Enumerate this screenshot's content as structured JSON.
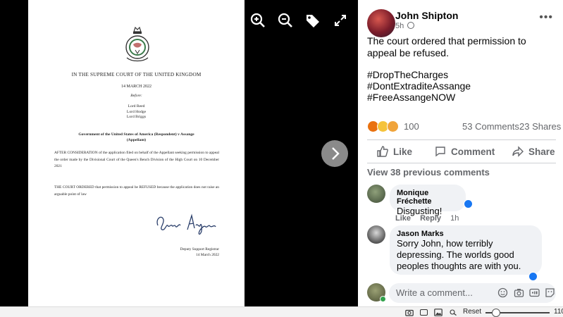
{
  "document": {
    "court": "IN THE SUPREME COURT OF THE UNITED KINGDOM",
    "date": "14 MARCH 2022",
    "before": "Before:",
    "judges": [
      "Lord Reed",
      "Lord Hodge",
      "Lord Briggs"
    ],
    "parties": "Government of the United States of America (Respondent) v Assange (Appellant)",
    "paragraph1": "AFTER CONSIDERATION of the application filed on behalf of the Appellant seeking permission to appeal the order made by the Divisional Court of the Queen's Bench Division of the High Court on 10 December 2021",
    "paragraph2": "THE COURT ORDERED that permission to appeal be REFUSED because the application does not raise an arguable point of law",
    "signature": "Louise Angus",
    "registrar_title": "Deputy Support Registrar",
    "registrar_date": "14 March 2022"
  },
  "viewer": {
    "zoom_in_icon": "zoom-in-icon",
    "zoom_out_icon": "zoom-out-icon",
    "tag_icon": "tag-icon",
    "fullscreen_icon": "fullscreen-icon",
    "next_icon": "chevron-right-icon"
  },
  "post": {
    "author": "John Shipton",
    "time": "5h",
    "text": "The court ordered that permission to appeal be refused.",
    "hashtags": [
      "#DropTheCharges",
      "#DontExtraditeAssange",
      "#FreeAssangeNOW"
    ],
    "reaction_count": "100",
    "comments_count": "53 Comments",
    "shares_count": "23 Shares",
    "actions": {
      "like": "Like",
      "comment": "Comment",
      "share": "Share"
    },
    "view_previous": "View 38 previous comments"
  },
  "comments": [
    {
      "author": "Monique Fréchette",
      "text": "Disgusting!",
      "like": "Like",
      "reply": "Reply",
      "time": "1h"
    },
    {
      "author": "Jason Marks",
      "text": "Sorry John, how terribly depressing. The worlds good peoples thoughts are with you."
    }
  ],
  "composer": {
    "placeholder": "Write a comment..."
  },
  "statusbar": {
    "reset": "Reset",
    "zoom": "110"
  },
  "colors": {
    "accent": "#1877f2",
    "muted": "#65676b",
    "bubble": "#f0f2f5"
  }
}
